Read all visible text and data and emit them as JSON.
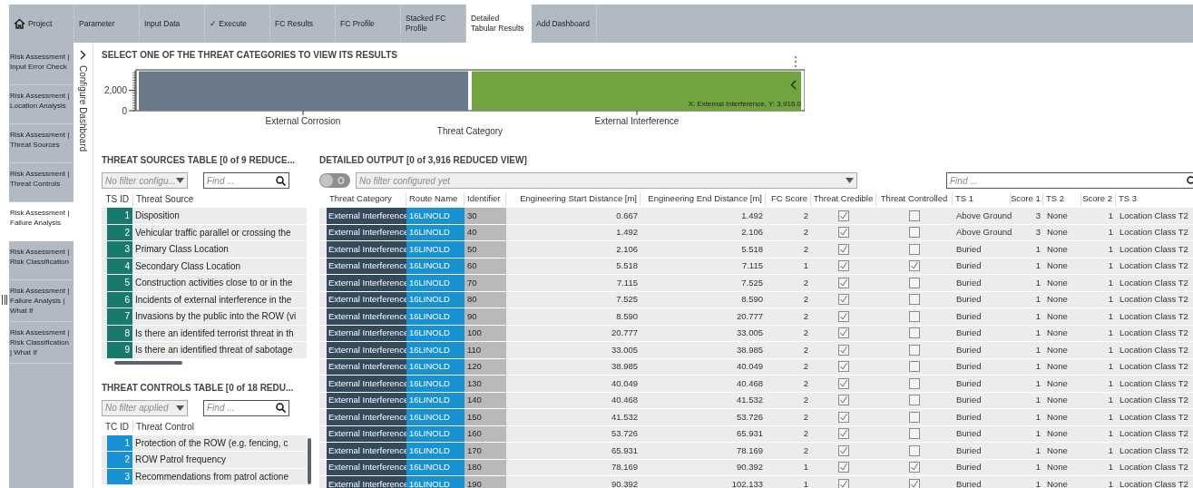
{
  "tabs": [
    {
      "kind": "home",
      "label": "Project",
      "selected": false
    },
    {
      "kind": "plain",
      "label": "Parameter",
      "selected": false
    },
    {
      "kind": "plain",
      "label": "Input Data",
      "selected": false
    },
    {
      "kind": "plain",
      "label": "✓ Execute",
      "selected": false
    },
    {
      "kind": "plain",
      "label": "FC Results",
      "selected": false
    },
    {
      "kind": "plain",
      "label": "FC Profile",
      "selected": false
    },
    {
      "kind": "plain",
      "label": "Stacked FC Profile",
      "selected": false
    },
    {
      "kind": "plain",
      "label": "Detailed Tabular Results",
      "selected": true
    },
    {
      "kind": "plain",
      "label": "Add Dashboard",
      "selected": false
    }
  ],
  "sidebar": {
    "items": [
      {
        "label": "Risk Assessment | Input Error Check",
        "selected": false
      },
      {
        "label": "Risk Assessment | Location Analysis",
        "selected": false
      },
      {
        "label": "Risk Assessment | Threat Sources",
        "selected": false
      },
      {
        "label": "Risk Assessment | Threat Controls",
        "selected": false
      },
      {
        "label": "Risk Assessment | Failure Analysis",
        "selected": true
      },
      {
        "label": "Risk Assessment | Risk Classification",
        "selected": false
      },
      {
        "label": "Risk Assessment | Failure Analysis | What If",
        "selected": false
      },
      {
        "label": "Risk Assessment | Risk Classification | What If",
        "selected": false
      }
    ]
  },
  "configure_panel": {
    "label": "Configure Dashboard"
  },
  "chart_section": {
    "title": "SELECT ONE OF THE THREAT CATEGORIES TO VIEW ITS RESULTS",
    "tooltip": "X: External Interference, Y: 3,916.0",
    "chart_data": {
      "type": "bar",
      "xlabel": "Threat Category",
      "categories": [
        "External Corrosion",
        "External Interference"
      ],
      "ylim": [
        0,
        3950
      ],
      "yticks": [
        0,
        {
          "value": 2000,
          "label": "2,000"
        }
      ],
      "series": [
        {
          "color": "#6a7a8a",
          "values": [
            3900,
            null
          ]
        },
        {
          "color": "#70a43e",
          "values": [
            null,
            3900
          ]
        }
      ]
    }
  },
  "threat_sources": {
    "title": "THREAT SOURCES TABLE [0 of 9 REDUCE...",
    "filter_placeholder": "No filter configu...",
    "find_placeholder": "Find ...",
    "columns": [
      "TS ID",
      "Threat Source"
    ],
    "rows": [
      {
        "id": "1",
        "text": "Disposition"
      },
      {
        "id": "2",
        "text": "Vehicular traffic parallel or crossing the"
      },
      {
        "id": "3",
        "text": "Primary Class Location"
      },
      {
        "id": "4",
        "text": "Secondary Class Location"
      },
      {
        "id": "5",
        "text": "Construction activities close to or in the"
      },
      {
        "id": "6",
        "text": "Incidents of external interference in the"
      },
      {
        "id": "7",
        "text": "Invasions by the public into the ROW (vi"
      },
      {
        "id": "8",
        "text": "Is there an identifed terrorist threat in th"
      },
      {
        "id": "9",
        "text": "Is there an identified threat of sabotage"
      }
    ]
  },
  "threat_controls": {
    "title": "THREAT CONTROLS TABLE [0 of 18 REDU...",
    "filter_placeholder": "No filter applied",
    "find_placeholder": "Find ...",
    "columns": [
      "TC ID",
      "Threat Control"
    ],
    "rows": [
      {
        "id": "1",
        "text": "Protection of the ROW (e.g. fencing, c"
      },
      {
        "id": "2",
        "text": "ROW Patrol frequency"
      },
      {
        "id": "3",
        "text": "Recommendations from patrol actione"
      }
    ]
  },
  "detailed_output": {
    "title": "DETAILED OUTPUT [0 of 3,916 REDUCED VIEW]",
    "toggle": {
      "on": false,
      "label": "O"
    },
    "filter_placeholder": "No filter configured yet",
    "find_placeholder": "Find ...",
    "columns": [
      "Threat Category",
      "Route Name",
      "Identifier",
      "Engineering Start Distance [m]",
      "Engineering End Distance [m]",
      "FC Score",
      "Threat Credible",
      "Threat Controlled",
      "TS 1",
      "Score 1",
      "TS 2",
      "Score 2",
      "TS 3"
    ],
    "rows": [
      {
        "category": "External Interference",
        "route": "16LINOLD",
        "identifier": "30",
        "start": "0.667",
        "end": "1.492",
        "fc_score": "2",
        "credible": true,
        "controlled": false,
        "ts1": "Above Ground",
        "score1": "3",
        "ts2": "None",
        "score2": "1",
        "ts3": "Location Class T2"
      },
      {
        "category": "External Interference",
        "route": "16LINOLD",
        "identifier": "40",
        "start": "1.492",
        "end": "2.106",
        "fc_score": "2",
        "credible": true,
        "controlled": false,
        "ts1": "Above Ground",
        "score1": "3",
        "ts2": "None",
        "score2": "1",
        "ts3": "Location Class T2"
      },
      {
        "category": "External Interference",
        "route": "16LINOLD",
        "identifier": "50",
        "start": "2.106",
        "end": "5.518",
        "fc_score": "2",
        "credible": true,
        "controlled": false,
        "ts1": "Buried",
        "score1": "1",
        "ts2": "None",
        "score2": "1",
        "ts3": "Location Class T2"
      },
      {
        "category": "External Interference",
        "route": "16LINOLD",
        "identifier": "60",
        "start": "5.518",
        "end": "7.115",
        "fc_score": "1",
        "credible": true,
        "controlled": true,
        "ts1": "Buried",
        "score1": "1",
        "ts2": "None",
        "score2": "1",
        "ts3": "Location Class T2"
      },
      {
        "category": "External Interference",
        "route": "16LINOLD",
        "identifier": "70",
        "start": "7.115",
        "end": "7.525",
        "fc_score": "2",
        "credible": true,
        "controlled": false,
        "ts1": "Buried",
        "score1": "1",
        "ts2": "None",
        "score2": "1",
        "ts3": "Location Class T2"
      },
      {
        "category": "External Interference",
        "route": "16LINOLD",
        "identifier": "80",
        "start": "7.525",
        "end": "8.590",
        "fc_score": "2",
        "credible": true,
        "controlled": false,
        "ts1": "Buried",
        "score1": "1",
        "ts2": "None",
        "score2": "1",
        "ts3": "Location Class T2"
      },
      {
        "category": "External Interference",
        "route": "16LINOLD",
        "identifier": "90",
        "start": "8.590",
        "end": "20.777",
        "fc_score": "2",
        "credible": true,
        "controlled": false,
        "ts1": "Buried",
        "score1": "1",
        "ts2": "None",
        "score2": "1",
        "ts3": "Location Class T2"
      },
      {
        "category": "External Interference",
        "route": "16LINOLD",
        "identifier": "100",
        "start": "20.777",
        "end": "33.005",
        "fc_score": "2",
        "credible": true,
        "controlled": false,
        "ts1": "Buried",
        "score1": "1",
        "ts2": "None",
        "score2": "1",
        "ts3": "Location Class T2"
      },
      {
        "category": "External Interference",
        "route": "16LINOLD",
        "identifier": "110",
        "start": "33.005",
        "end": "38.985",
        "fc_score": "2",
        "credible": true,
        "controlled": false,
        "ts1": "Buried",
        "score1": "1",
        "ts2": "None",
        "score2": "1",
        "ts3": "Location Class T2"
      },
      {
        "category": "External Interference",
        "route": "16LINOLD",
        "identifier": "120",
        "start": "38.985",
        "end": "40.049",
        "fc_score": "2",
        "credible": true,
        "controlled": false,
        "ts1": "Buried",
        "score1": "1",
        "ts2": "None",
        "score2": "1",
        "ts3": "Location Class T2"
      },
      {
        "category": "External Interference",
        "route": "16LINOLD",
        "identifier": "130",
        "start": "40.049",
        "end": "40.468",
        "fc_score": "2",
        "credible": true,
        "controlled": false,
        "ts1": "Buried",
        "score1": "1",
        "ts2": "None",
        "score2": "1",
        "ts3": "Location Class T2"
      },
      {
        "category": "External Interference",
        "route": "16LINOLD",
        "identifier": "140",
        "start": "40.468",
        "end": "41.532",
        "fc_score": "2",
        "credible": true,
        "controlled": false,
        "ts1": "Buried",
        "score1": "1",
        "ts2": "None",
        "score2": "1",
        "ts3": "Location Class T2"
      },
      {
        "category": "External Interference",
        "route": "16LINOLD",
        "identifier": "150",
        "start": "41.532",
        "end": "53.726",
        "fc_score": "2",
        "credible": true,
        "controlled": false,
        "ts1": "Buried",
        "score1": "1",
        "ts2": "None",
        "score2": "1",
        "ts3": "Location Class T2"
      },
      {
        "category": "External Interference",
        "route": "16LINOLD",
        "identifier": "160",
        "start": "53.726",
        "end": "65.931",
        "fc_score": "2",
        "credible": true,
        "controlled": false,
        "ts1": "Buried",
        "score1": "1",
        "ts2": "None",
        "score2": "1",
        "ts3": "Location Class T2"
      },
      {
        "category": "External Interference",
        "route": "16LINOLD",
        "identifier": "170",
        "start": "65.931",
        "end": "78.169",
        "fc_score": "2",
        "credible": true,
        "controlled": false,
        "ts1": "Buried",
        "score1": "1",
        "ts2": "None",
        "score2": "1",
        "ts3": "Location Class T2"
      },
      {
        "category": "External Interference",
        "route": "16LINOLD",
        "identifier": "180",
        "start": "78.169",
        "end": "90.392",
        "fc_score": "1",
        "credible": true,
        "controlled": true,
        "ts1": "Buried",
        "score1": "1",
        "ts2": "None",
        "score2": "1",
        "ts3": "Location Class T2"
      },
      {
        "category": "External Interference",
        "route": "16LINOLD",
        "identifier": "190",
        "start": "90.392",
        "end": "102.133",
        "fc_score": "1",
        "credible": true,
        "controlled": true,
        "ts1": "Buried",
        "score1": "1",
        "ts2": "None",
        "score2": "1",
        "ts3": "Location Class T2"
      }
    ]
  }
}
